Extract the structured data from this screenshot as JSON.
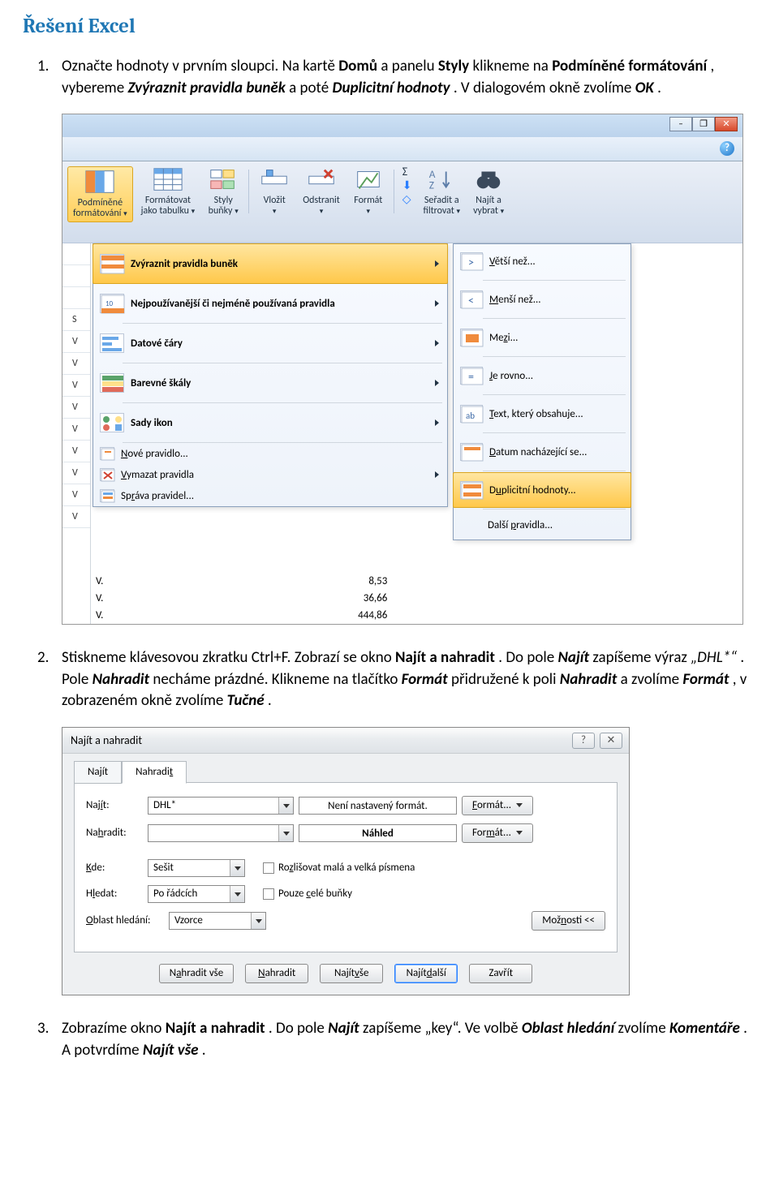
{
  "title": "Řešení Excel",
  "steps": {
    "s1_num": "1.",
    "s1_a": "Označte hodnoty v prvním sloupci. Na kartě ",
    "s1_b1": "Domů",
    "s1_c": " a panelu ",
    "s1_b2": "Styly",
    "s1_d": " klikneme na ",
    "s1_b3": "Podmíněné formátování ",
    "s1_e": ", vybereme ",
    "s1_bi1": "Zvýraznit pravidla buněk",
    "s1_f": " a poté ",
    "s1_bi2": "Duplicitní hodnoty",
    "s1_g": ". V dialogovém okně zvolíme ",
    "s1_bi3": "OK",
    "s1_h": ".",
    "s2_num": "2.",
    "s2_a": "Stiskneme klávesovou zkratku Ctrl+F. Zobrazí se okno ",
    "s2_b1": "Najít a nahradit",
    "s2_c": ". Do pole ",
    "s2_bi1": "Najít",
    "s2_d": " zapíšeme výraz ",
    "s2_i1": "„DHL*“",
    "s2_e": ". Pole ",
    "s2_bi2": "Nahradit",
    "s2_f": " necháme prázdné. Klikneme na tlačítko ",
    "s2_bi3": "Formát",
    "s2_g": " přidružené k poli ",
    "s2_bi4": "Nahradit",
    "s2_h": " a zvolíme ",
    "s2_bi5": "Formát",
    "s2_i": ", v zobrazeném okně zvolíme ",
    "s2_bi6": "Tučné",
    "s2_j": ".",
    "s3_num": "3.",
    "s3_a": "Zobrazíme okno ",
    "s3_b1": "Najít a nahradit",
    "s3_b": ". Do pole ",
    "s3_bi1": "Najít",
    "s3_c": " zapíšeme „key“. Ve volbě ",
    "s3_bi2": "Oblast hledání",
    "s3_d": " zvolíme ",
    "s3_bi3": "Komentáře",
    "s3_e": ". A potvrdíme ",
    "s3_bi4": "Najít vše",
    "s3_f": "."
  },
  "ribbon": {
    "cond_fmt_l1": "Podmíněné",
    "cond_fmt_l2": "formátování",
    "fmt_table_l1": "Formátovat",
    "fmt_table_l2": "jako tabulku",
    "styles_l1": "Styly",
    "styles_l2": "buňky",
    "insert": "Vložit",
    "delete": "Odstranit",
    "format": "Formát",
    "sigma": "Σ",
    "fill": "⬇",
    "clear": "◇",
    "sort_l1": "Seřadit a",
    "sort_l2": "filtrovat",
    "find_l1": "Najít a",
    "find_l2": "vybrat"
  },
  "menu1": {
    "i1": "Zvýraznit pravidla buněk",
    "i2": "Nejpoužívanější či nejméně používaná pravidla",
    "i3": "Datové čáry",
    "i4": "Barevné škály",
    "i5": "Sady ikon",
    "i6": "Nové pravidlo...",
    "i7": "Vymazat pravidla",
    "i8": "Správa pravidel..."
  },
  "menu2": {
    "i1": "Větší než...",
    "i2": "Menší než...",
    "i3": "Mezi...",
    "i4": "Je rovno...",
    "i5": "Text, který obsahuje...",
    "i6": "Datum nacházející se...",
    "i7": "Duplicitní hodnoty...",
    "more": "Další pravidla..."
  },
  "row_letters": [
    "S",
    "V",
    "V",
    "V",
    "V",
    "V",
    "V",
    "V",
    "V",
    "V",
    "V.",
    "V.",
    "V."
  ],
  "cells": {
    "r1c1": "V.",
    "r1c2": "8,53",
    "r2c1": "V.",
    "r2c2": "36,66",
    "r3c1": "V.",
    "r3c2": "444,86"
  },
  "dlg": {
    "title": "Najít a nahradit",
    "tab_find": "Najít",
    "tab_replace": "Nahradit",
    "lbl_find": "Najít:",
    "lbl_replace": "Nahradit:",
    "val_find": "DHL*",
    "fmt_none": "Není nastavený formát.",
    "fmt_preview": "Náhled",
    "btn_format": "Formát...",
    "lbl_where": "Kde:",
    "lbl_search": "Hledat:",
    "lbl_lookin": "Oblast hledání:",
    "val_where": "Sešit",
    "val_search": "Po řádcích",
    "val_lookin": "Vzorce",
    "chk_case": "Rozlišovat malá a velká písmena",
    "chk_whole": "Pouze celé buňky",
    "btn_options": "Možnosti <<",
    "btn_replace_all": "Nahradit vše",
    "btn_replace": "Nahradit",
    "btn_find_all": "Najít vše",
    "btn_find_next": "Najít další",
    "btn_close": "Zavřít",
    "help": "?",
    "close_x": "✕"
  }
}
